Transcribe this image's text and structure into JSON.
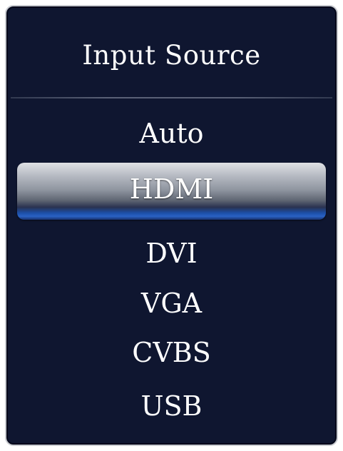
{
  "menu": {
    "title": "Input Source",
    "selected_index": 1,
    "options": [
      {
        "label": "Auto"
      },
      {
        "label": "HDMI"
      },
      {
        "label": "DVI"
      },
      {
        "label": "VGA"
      },
      {
        "label": "CVBS"
      },
      {
        "label": "USB"
      }
    ]
  },
  "colors": {
    "panel_background": "#0f1630",
    "panel_border": "#c9cbd0",
    "text": "#ffffff",
    "selection_highlight": "#2a62c4"
  }
}
